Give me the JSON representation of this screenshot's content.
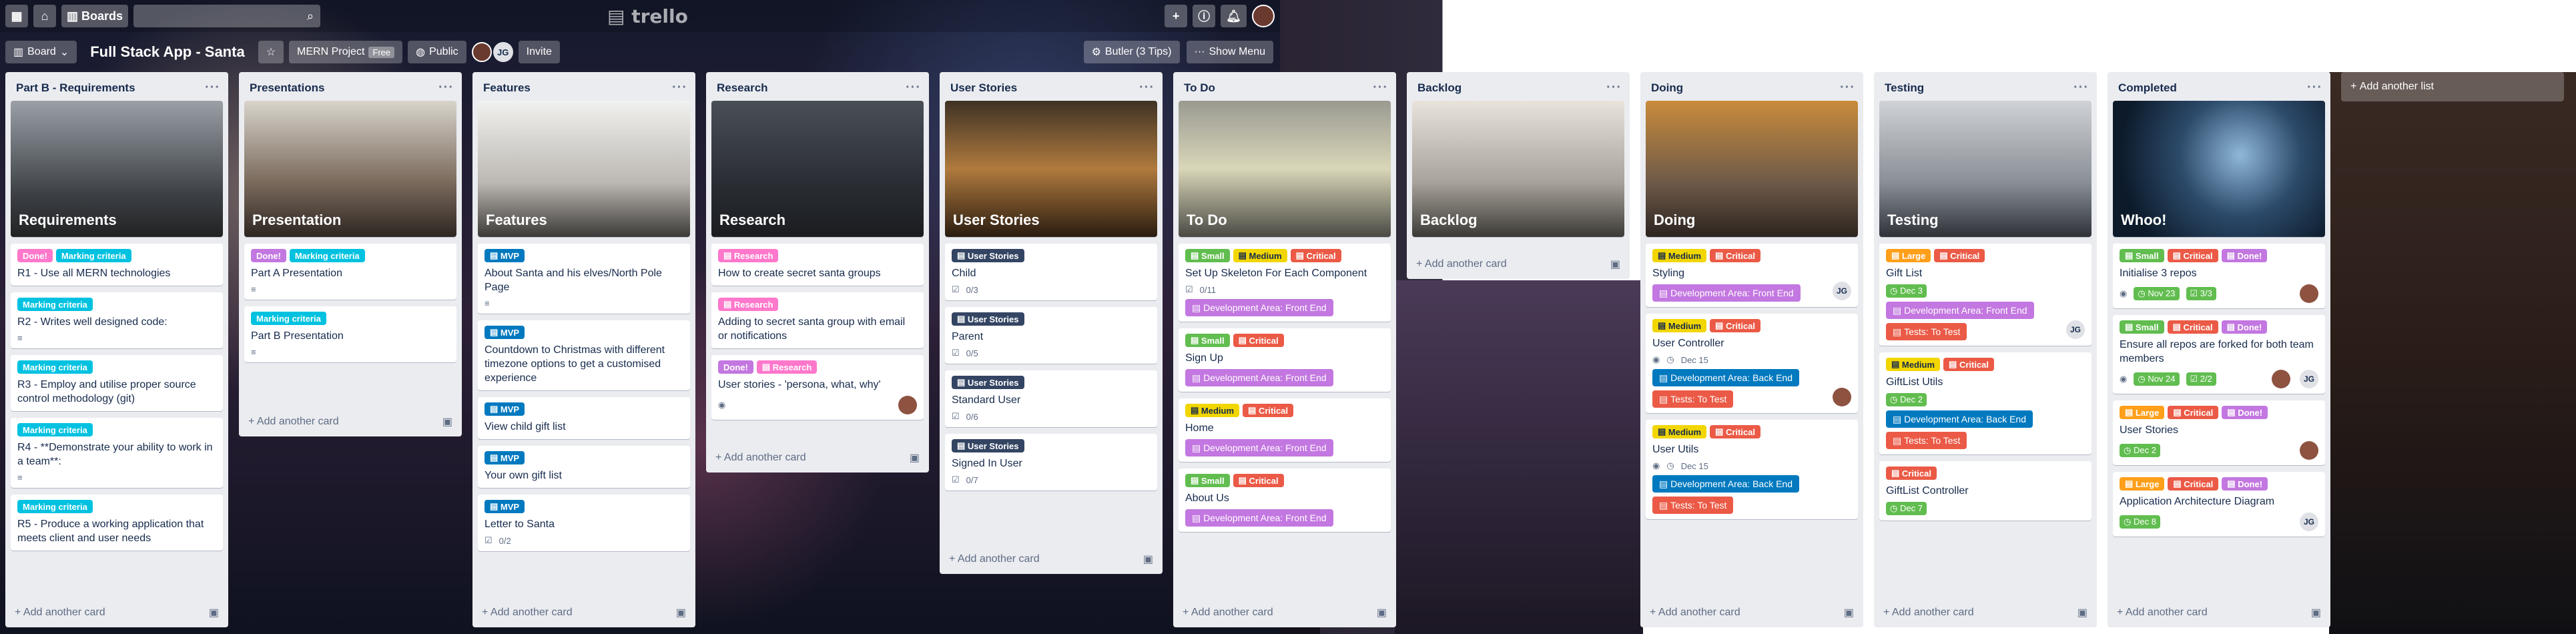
{
  "topbar": {
    "boards_label": "Boards",
    "logo": "trello"
  },
  "header": {
    "board_menu": "Board",
    "board_title": "Full Stack App - Santa",
    "team": "MERN Project",
    "team_badge": "Free",
    "visibility": "Public",
    "member_initials": "JG",
    "invite": "Invite",
    "butler": "Butler (3 Tips)",
    "show_menu": "Show Menu"
  },
  "common": {
    "add_card": "Add another card",
    "add_list": "Add another list"
  },
  "lists": [
    {
      "title": "Part B - Requirements"
    },
    {
      "title": "Presentations"
    },
    {
      "title": "Features"
    },
    {
      "title": "Research"
    },
    {
      "title": "User Stories"
    },
    {
      "title": "To Do"
    },
    {
      "title": "Backlog"
    },
    {
      "title": "Doing"
    },
    {
      "title": "Testing"
    },
    {
      "title": "Completed"
    }
  ],
  "cards": {
    "req_cover": "Requirements",
    "req1": "R1 - Use all MERN technologies",
    "req2": "R2 - Writes well designed code:",
    "req3": "R3 - Employ and utilise proper source control methodology (git)",
    "req4": "R4 - **Demonstrate your ability to work in a team**:",
    "req5": "R5 - Produce a working application that meets client and user needs",
    "pres_cover": "Presentation",
    "presA": "Part A Presentation",
    "presB": "Part B Presentation",
    "feat_cover": "Features",
    "feat1": "About Santa and his elves/North Pole Page",
    "feat2": "Countdown to Christmas with different timezone options to get a customised experience",
    "feat3": "View child gift list",
    "feat4": "Your own gift list",
    "feat5": "Letter to Santa",
    "feat5_check": "0/2",
    "res_cover": "Research",
    "res1": "How to create secret santa groups",
    "res2": "Adding to secret santa group with email or notifications",
    "res3": "User stories - 'persona, what, why'",
    "us_cover": "User Stories",
    "us1": "Child",
    "us1_check": "0/3",
    "us2": "Parent",
    "us2_check": "0/5",
    "us3": "Standard User",
    "us3_check": "0/6",
    "us4": "Signed In User",
    "us4_check": "0/7",
    "todo_cover": "To Do",
    "todo1": "Set Up Skeleton For Each Component",
    "todo1_check": "0/11",
    "todo2": "Sign Up",
    "todo3": "Home",
    "todo4": "About Us",
    "backlog_cover": "Backlog",
    "doing_cover": "Doing",
    "doing1": "Styling",
    "doing2": "User Controller",
    "doing2_due": "Dec 15",
    "doing3": "User Utils",
    "doing3_due": "Dec 15",
    "test_cover": "Testing",
    "test1": "Gift List",
    "test1_due": "Dec 3",
    "test2": "GiftList Utils",
    "test2_due": "Dec 2",
    "test3": "GiftList Controller",
    "test3_due": "Dec 7",
    "done_cover": "Whoo!",
    "done1": "Initialise 3 repos",
    "done1_due": "Nov 23",
    "done1_check": "3/3",
    "done2": "Ensure all repos are forked for both team members",
    "done2_due": "Nov 24",
    "done2_check": "2/2",
    "done3": "User Stories",
    "done3_due": "Dec 2",
    "done4": "Application Architecture Diagram",
    "done4_due": "Dec 8"
  },
  "labels": {
    "done": "Done!",
    "marking": "Marking criteria",
    "mvp": "MVP",
    "research": "Research",
    "user_stories": "User Stories",
    "small": "Small",
    "medium": "Medium",
    "large": "Large",
    "critical": "Critical",
    "dev_front": "Development Area: Front End",
    "dev_back": "Development Area: Back End",
    "tests_todo": "Tests: To Test"
  },
  "colors": {
    "green": "#61bd4f",
    "yellow": "#f2d600",
    "orange": "#ff9f1a",
    "red": "#eb5a46",
    "purple": "#c377e0",
    "blue": "#0079bf",
    "sky": "#00c2e0",
    "pink": "#ff78cb",
    "black": "#344563"
  }
}
